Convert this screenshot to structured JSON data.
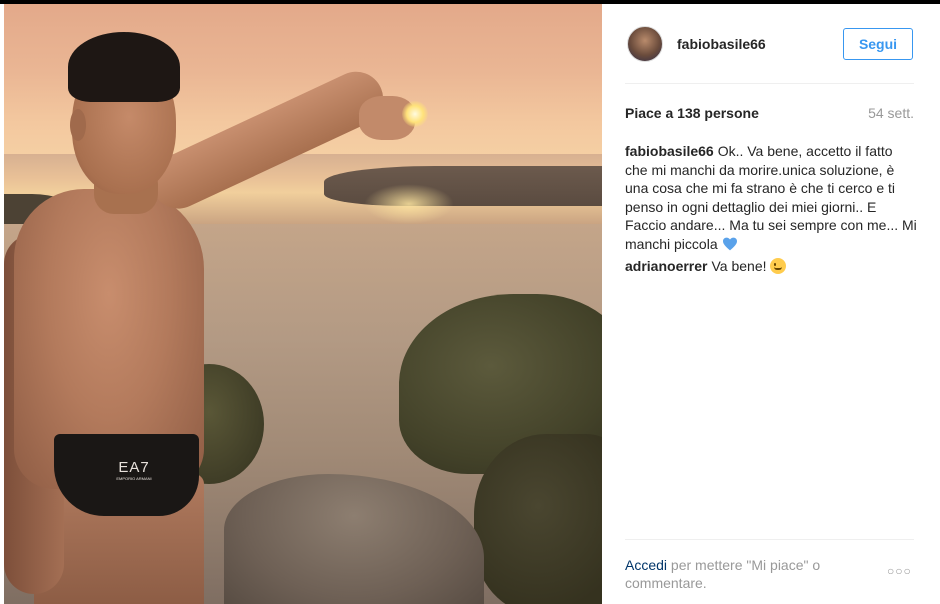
{
  "post": {
    "username": "fabiobasile66",
    "follow_label": "Segui",
    "likes_text": "Piace a 138 persone",
    "time_ago": "54 sett.",
    "comments": [
      {
        "author": "fabiobasile66",
        "text": "Ok.. Va bene, accetto il fatto che mi manchi da morire.unica soluzione, è una cosa che mi fa strano è che ti cerco e ti penso in ogni dettaglio dei miei giorni.. E Faccio andare... Ma tu sei sempre con me... Mi manchi piccola",
        "emoji": "blue-heart"
      },
      {
        "author": "adrianoerrer",
        "text": "Va bene!",
        "emoji": "relieved-face"
      }
    ],
    "photo_logo_text": "EA7",
    "photo_logo_subtext": "EMPORIO ARMANI"
  },
  "footer": {
    "login_label": "Accedi",
    "login_suffix": " per mettere \"Mi piace\" o commentare.",
    "more_icon": "ellipsis-icon"
  },
  "colors": {
    "accent": "#3897f0",
    "heart": "#5aa2ea",
    "text": "#262626",
    "muted": "#999999"
  }
}
